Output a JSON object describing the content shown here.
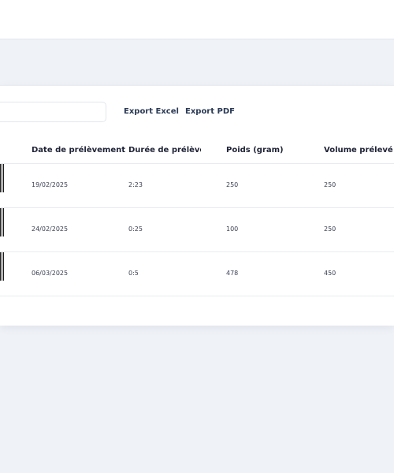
{
  "actions": {
    "export_excel": "Export Excel",
    "export_pdf": "Export PDF"
  },
  "table": {
    "headers": [
      "Date de prélèvement",
      "Durée de prélève...",
      "Poids (gram)",
      "Volume prélevé (ml"
    ],
    "rows": [
      [
        "19/02/2025",
        "2:23",
        "250",
        "250"
      ],
      [
        "24/02/2025",
        "0:25",
        "100",
        "250"
      ],
      [
        "06/03/2025",
        "0:5",
        "478",
        "450"
      ]
    ]
  },
  "colors": {
    "page_bg": "#eff2f7",
    "card_bg": "#ffffff",
    "link": "#2b3a55"
  }
}
